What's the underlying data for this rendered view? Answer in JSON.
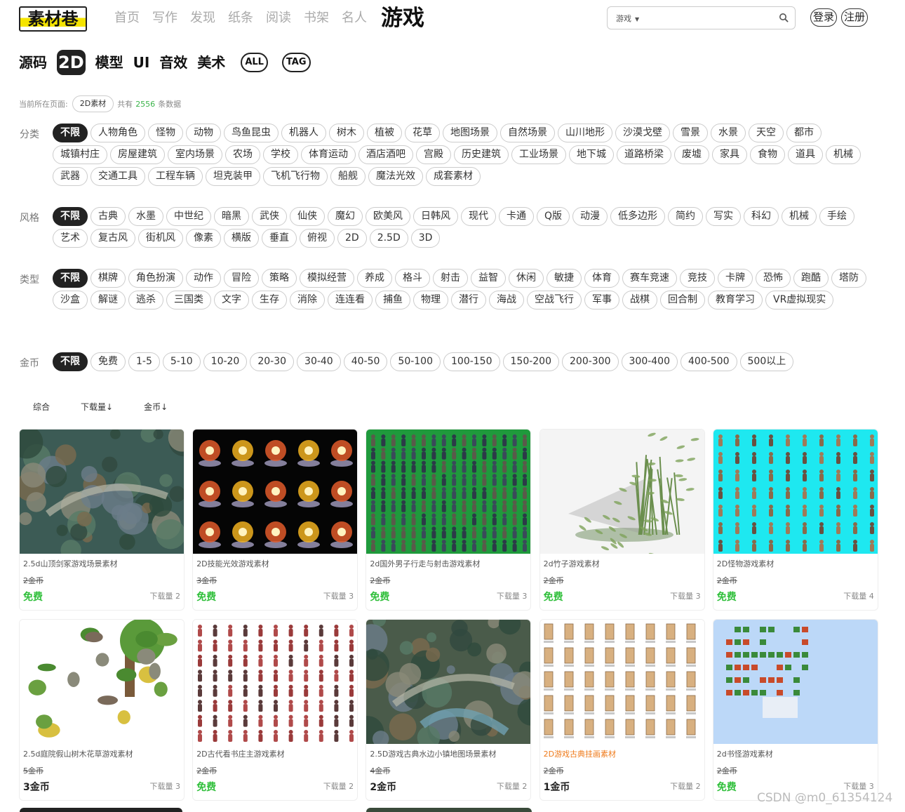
{
  "header": {
    "logo_text": "素材巷",
    "nav": [
      "首页",
      "写作",
      "发现",
      "纸条",
      "阅读",
      "书架",
      "名人"
    ],
    "active_nav": "游戏",
    "search": {
      "type_label": "游戏",
      "placeholder": ""
    },
    "login": "登录",
    "register": "注册"
  },
  "sections": [
    "源码",
    "2D",
    "模型",
    "UI",
    "音效",
    "美术",
    "ALL",
    "TAG"
  ],
  "breadcrumb": {
    "prefix": "当前所在页面:",
    "current": "2D素材",
    "total_prefix": "共有",
    "total": "2556",
    "total_suffix": "条数据"
  },
  "filters": {
    "category": {
      "label": "分类",
      "options": [
        "不限",
        "人物角色",
        "怪物",
        "动物",
        "鸟鱼昆虫",
        "机器人",
        "树木",
        "植被",
        "花草",
        "地图场景",
        "自然场景",
        "山川地形",
        "沙漠戈壁",
        "雪景",
        "水景",
        "天空",
        "都市",
        "城镇村庄",
        "房屋建筑",
        "室内场景",
        "农场",
        "学校",
        "体育运动",
        "酒店酒吧",
        "宫殿",
        "历史建筑",
        "工业场景",
        "地下城",
        "道路桥梁",
        "废墟",
        "家具",
        "食物",
        "道具",
        "机械",
        "武器",
        "交通工具",
        "工程车辆",
        "坦克装甲",
        "飞机飞行物",
        "船舰",
        "魔法光效",
        "成套素材"
      ]
    },
    "style": {
      "label": "风格",
      "options": [
        "不限",
        "古典",
        "水墨",
        "中世纪",
        "暗黑",
        "武侠",
        "仙侠",
        "魔幻",
        "欧美风",
        "日韩风",
        "现代",
        "卡通",
        "Q版",
        "动漫",
        "低多边形",
        "简约",
        "写实",
        "科幻",
        "机械",
        "手绘",
        "艺术",
        "复古风",
        "街机风",
        "像素",
        "横版",
        "垂直",
        "俯视",
        "2D",
        "2.5D",
        "3D"
      ]
    },
    "genre": {
      "label": "类型",
      "options": [
        "不限",
        "棋牌",
        "角色扮演",
        "动作",
        "冒险",
        "策略",
        "模拟经营",
        "养成",
        "格斗",
        "射击",
        "益智",
        "休闲",
        "敏捷",
        "体育",
        "赛车竞速",
        "竞技",
        "卡牌",
        "恐怖",
        "跑酷",
        "塔防",
        "沙盒",
        "解谜",
        "逃杀",
        "三国类",
        "文字",
        "生存",
        "消除",
        "连连看",
        "捕鱼",
        "物理",
        "潜行",
        "海战",
        "空战飞行",
        "军事",
        "战棋",
        "回合制",
        "教育学习",
        "VR虚拟现实"
      ]
    },
    "coins": {
      "label": "金币",
      "options": [
        "不限",
        "免费",
        "1-5",
        "5-10",
        "10-20",
        "20-30",
        "30-40",
        "40-50",
        "50-100",
        "100-150",
        "150-200",
        "200-300",
        "300-400",
        "400-500",
        "500以上"
      ]
    }
  },
  "sort": [
    "综合",
    "下载量↓",
    "金币↓"
  ],
  "cards": [
    {
      "title": "2.5d山顶剑冢游戏场景素材",
      "orig": "2金币",
      "price": "免费",
      "free": true,
      "downloads": "下载量 2",
      "thumb": "scene"
    },
    {
      "title": "2D技能光效游戏素材",
      "orig": "3金币",
      "price": "免费",
      "free": true,
      "downloads": "下载量 3",
      "thumb": "effects"
    },
    {
      "title": "2d国外男子行走与射击游戏素材",
      "orig": "2金币",
      "price": "免费",
      "free": true,
      "downloads": "下载量 3",
      "thumb": "sprites-green"
    },
    {
      "title": "2d竹子游戏素材",
      "orig": "2金币",
      "price": "免费",
      "free": true,
      "downloads": "下载量 3",
      "thumb": "bamboo"
    },
    {
      "title": "2D怪物游戏素材",
      "orig": "2金币",
      "price": "免费",
      "free": true,
      "downloads": "下载量 4",
      "thumb": "sprites-cyan"
    },
    {
      "title": "2.5d庭院假山树木花草游戏素材",
      "orig": "5金币",
      "price": "3金币",
      "free": false,
      "downloads": "下载量 3",
      "thumb": "garden"
    },
    {
      "title": "2D古代看书庄主游戏素材",
      "orig": "2金币",
      "price": "免费",
      "free": true,
      "downloads": "下载量 2",
      "thumb": "sprites-white"
    },
    {
      "title": "2.5D游戏古典水边小镇地图场景素材",
      "orig": "4金币",
      "price": "2金币",
      "free": false,
      "downloads": "下载量 2",
      "thumb": "town"
    },
    {
      "title": "2D游戏古典挂画素材",
      "orig": "2金币",
      "price": "1金币",
      "free": false,
      "downloads": "下载量 2",
      "thumb": "scrolls",
      "highlight": true
    },
    {
      "title": "2d书怪游戏素材",
      "orig": "2金币",
      "price": "免费",
      "free": true,
      "downloads": "下载量 3",
      "thumb": "book-monster"
    }
  ],
  "watermark": "CSDN @m0_61354124"
}
